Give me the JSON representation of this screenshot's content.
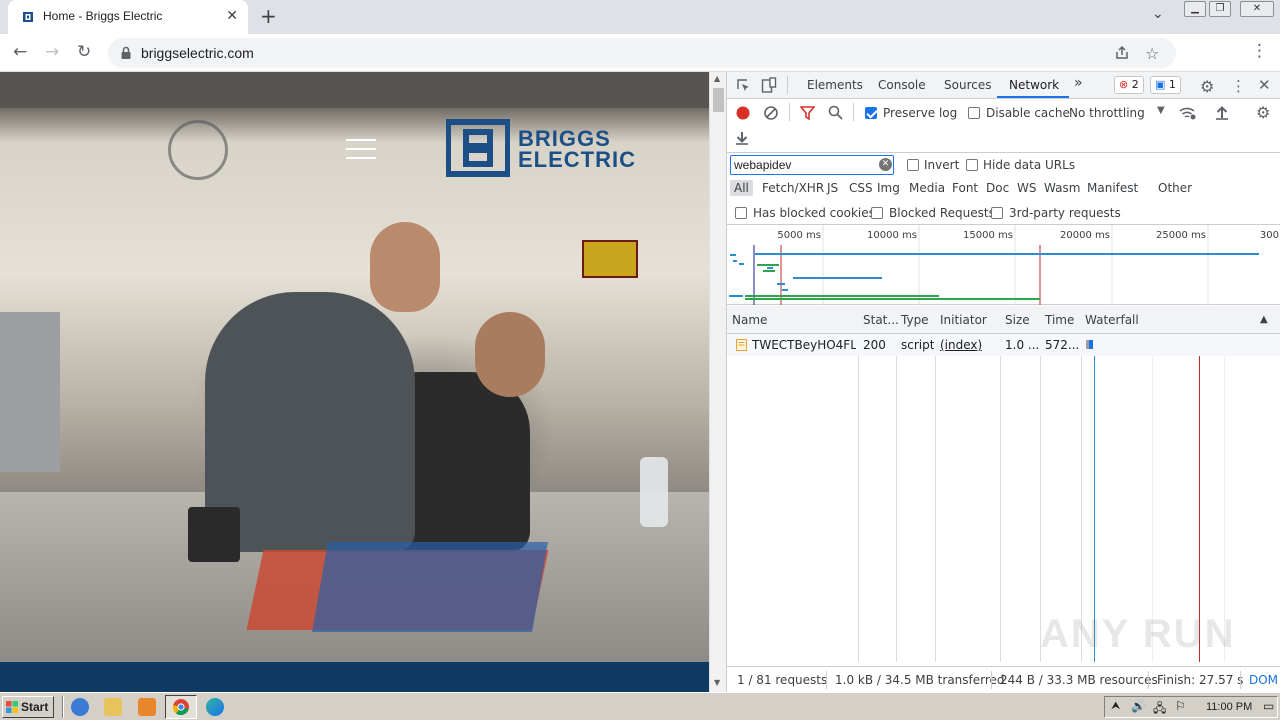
{
  "browser": {
    "tab_title": "Home - Briggs Electric",
    "url": "briggselectric.com",
    "new_tab_symbol": "+",
    "tab_close_symbol": "✕"
  },
  "website": {
    "logo_line1": "BRIGGS",
    "logo_line2": "ELECTRIC",
    "brand_color": "#1c4f86"
  },
  "devtools": {
    "tabs": [
      "Elements",
      "Console",
      "Sources",
      "Network"
    ],
    "active_tab": "Network",
    "more_tabs_symbol": "»",
    "error_count": "2",
    "message_count": "1",
    "toolbar": {
      "preserve_log": "Preserve log",
      "preserve_log_checked": true,
      "disable_cache": "Disable cache",
      "disable_cache_checked": false,
      "throttling": "No throttling"
    },
    "filter": {
      "value": "webapidev",
      "invert": "Invert",
      "hide_data_urls": "Hide data URLs",
      "types": [
        "All",
        "Fetch/XHR",
        "JS",
        "CSS",
        "Img",
        "Media",
        "Font",
        "Doc",
        "WS",
        "Wasm",
        "Manifest",
        "Other"
      ],
      "active_type": "All",
      "has_blocked_cookies": "Has blocked cookies",
      "blocked_requests": "Blocked Requests",
      "third_party": "3rd-party requests"
    },
    "overview_ticks": [
      "5000 ms",
      "10000 ms",
      "15000 ms",
      "20000 ms",
      "25000 ms",
      "300"
    ],
    "columns": [
      "Name",
      "Stat...",
      "Type",
      "Initiator",
      "Size",
      "Time",
      "Waterfall"
    ],
    "rows": [
      {
        "name": "TWECTBeyHO4FL...",
        "status": "200",
        "type": "script",
        "initiator": "(index)",
        "size": "1.0 ...",
        "time": "572..."
      }
    ],
    "status_bar": {
      "requests": "1 / 81 requests",
      "transferred": "1.0 kB / 34.5 MB transferred",
      "resources": "244 B / 33.3 MB resources",
      "finish": "Finish: 27.57 s",
      "dom": "DOM"
    }
  },
  "watermark": "ANY RUN",
  "taskbar": {
    "start_label": "Start",
    "clock": "11:00 PM"
  }
}
